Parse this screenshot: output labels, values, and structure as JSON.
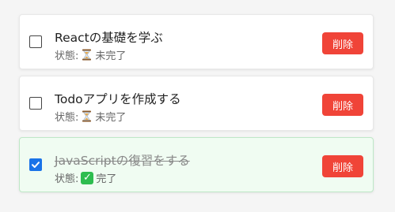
{
  "todos": [
    {
      "title": "Reactの基礎を学ぶ",
      "status_label": "状態:",
      "status_icon": "hourglass-icon",
      "status_text": "未完了",
      "completed": false,
      "delete_label": "削除"
    },
    {
      "title": "Todoアプリを作成する",
      "status_label": "状態:",
      "status_icon": "hourglass-icon",
      "status_text": "未完了",
      "completed": false,
      "delete_label": "削除"
    },
    {
      "title": "JavaScriptの復習をする",
      "status_label": "状態:",
      "status_icon": "check-mark-icon",
      "status_text": "完了",
      "completed": true,
      "delete_label": "削除"
    }
  ],
  "colors": {
    "delete_button": "#f04438",
    "checked_box": "#1a73e8",
    "done_card_background": "#f0fcf2"
  }
}
